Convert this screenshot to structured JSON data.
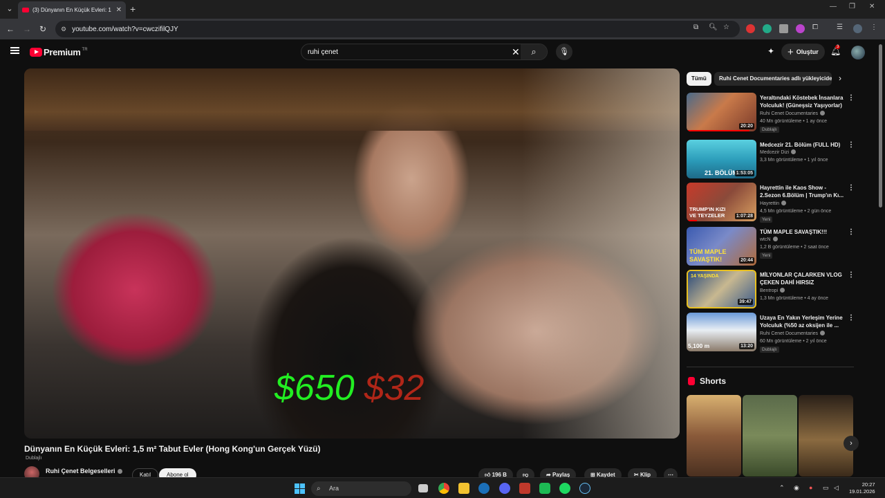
{
  "browser": {
    "tab_title": "(3) Dünyanın En Küçük Evleri: 1",
    "url": "youtube.com/watch?v=cwczifilQJY"
  },
  "header": {
    "logo_text": "Premium",
    "logo_region": "TR",
    "search_query": "ruhi çenet",
    "create_label": "Oluştur",
    "notification_count": "3"
  },
  "video": {
    "overlay_green": "$650",
    "overlay_red": "$32",
    "title": "Dünyanın En Küçük Evleri: 1,5 m² Tabut Evler (Hong Kong'un Gerçek Yüzü)",
    "dubbed_label": "Dublajlı",
    "channel_name": "Ruhi Çenet Belgeselleri",
    "join_label": "Katıl",
    "subscribe_label": "Abone ol",
    "like_count": "196 B",
    "share_label": "Paylaş",
    "save_label": "Kaydet",
    "clip_label": "Klip"
  },
  "sidebar": {
    "chips": [
      "Tümü",
      "Ruhi Cenet Documentaries adlı yükleyiciden"
    ],
    "recommendations": [
      {
        "title": "Yeraltındaki Köstebek İnsanlara Yolculuk! (Güneşsiz Yaşıyorlar)",
        "channel": "Ruhi Cenet Documentaries",
        "meta": "40 Mn görüntüleme • 1 ay önce",
        "badge": "Dublajlı",
        "duration": "20:20",
        "progress": 0.9
      },
      {
        "title": "Medcezir 21. Bölüm (FULL HD)",
        "channel": "Medcezir Dizi",
        "meta": "3,3 Mn görüntüleme • 1 yıl önce",
        "badge": "",
        "duration": "1:53:05",
        "thumb_text": "21. BÖLÜM",
        "progress": 0
      },
      {
        "title": "Hayrettin ile Kaos Show - 2.Sezon 6.Bölüm | Trump'ın Kı...",
        "channel": "Hayrettin",
        "meta": "4,5 Mn görüntüleme • 2 gün önce",
        "badge": "Yeni",
        "duration": "1:07:28",
        "thumb_text": "TRUMP'IN KIZI VE TEYZELER",
        "progress": 0.15
      },
      {
        "title": "TÜM MAPLE SAVAŞTIK!!!",
        "channel": "wtcN",
        "meta": "1,2 B görüntüleme • 2 saat önce",
        "badge": "Yeni",
        "duration": "20:44",
        "thumb_text": "TÜM MAPLE SAVAŞTIK!",
        "progress": 0
      },
      {
        "title": "MİLYONLAR ÇALARKEN VLOG ÇEKEN DAHİ HIRSIZ",
        "channel": "Bentropi",
        "meta": "1,3 Mn görüntüleme • 4 ay önce",
        "badge": "",
        "duration": "39:47",
        "thumb_text": "14 YAŞINDA",
        "progress": 0
      },
      {
        "title": "Uzaya En Yakın Yerleşim Yerine Yolculuk (%50 az oksijen ile ...",
        "channel": "Ruhi Cenet Documentaries",
        "meta": "60 Mn görüntüleme • 2 yıl önce",
        "badge": "Dublajlı",
        "duration": "13:20",
        "thumb_text": "5,100 m",
        "progress": 0
      }
    ],
    "shorts_title": "Shorts"
  },
  "taskbar": {
    "search_label": "Ara",
    "time": "20:27",
    "date": "19.01.2026"
  },
  "colors": {
    "youtube_red": "#ff0033",
    "overlay_green": "#22ee22",
    "overlay_red": "#cc2a1a"
  }
}
